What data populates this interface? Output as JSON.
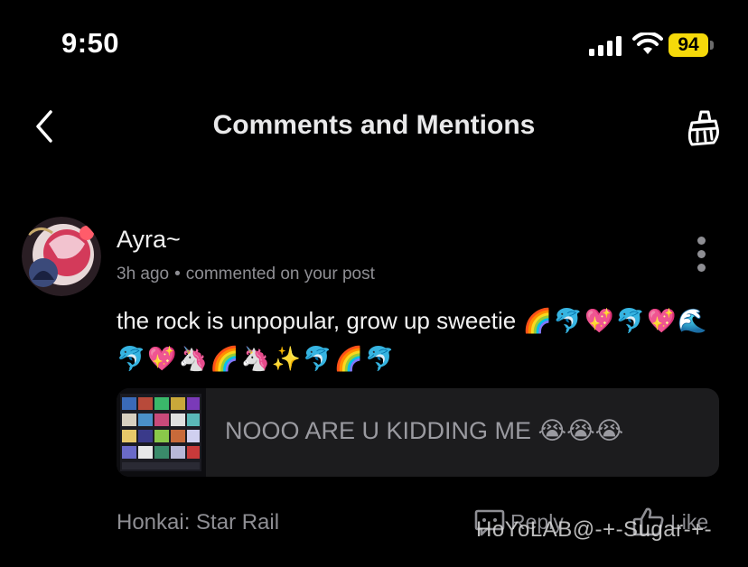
{
  "status_bar": {
    "time": "9:50",
    "battery": "94"
  },
  "header": {
    "title": "Comments and Mentions"
  },
  "comment": {
    "username": "Ayra~",
    "time_ago": "3h ago",
    "separator": "•",
    "action": "commented on your post",
    "text": "the rock is unpopular, grow up sweetie",
    "emojis": "🌈🐬💖🐬💖🌊🐬💖🦄🌈🦄✨🐬🌈🐬",
    "quoted_post": "NOOO ARE U KIDDING ME 😭😭😭"
  },
  "footer": {
    "game": "Honkai: Star Rail",
    "reply_label": "Reply",
    "like_label": "Like"
  },
  "watermark": "HoYoLAB@-+-Sugar-+-",
  "colors": {
    "accent_battery": "#f5d90a",
    "card_bg": "#1c1c1e",
    "muted": "#8e8e93"
  }
}
